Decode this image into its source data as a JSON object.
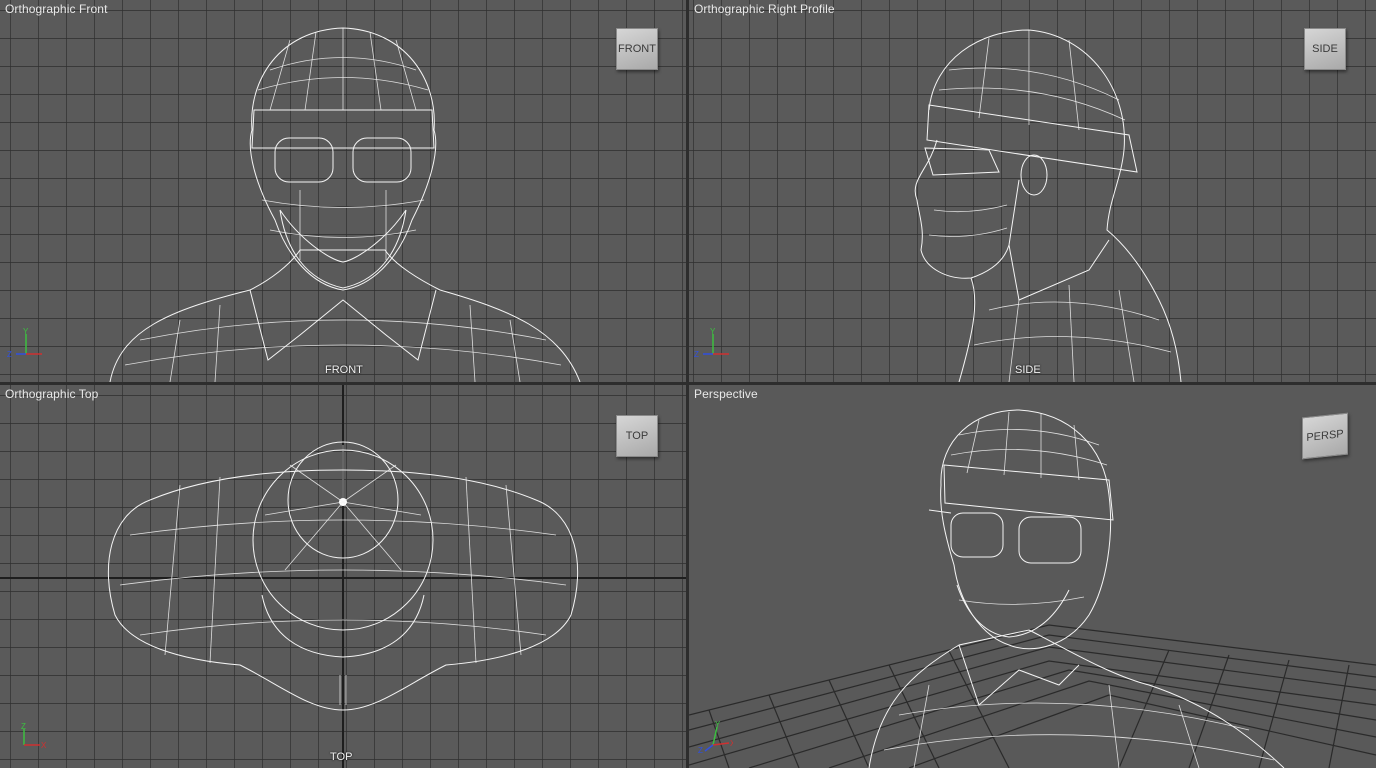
{
  "viewports": {
    "front": {
      "title": "Orthographic Front",
      "cube_label": "FRONT",
      "bottom_label": "FRONT"
    },
    "side": {
      "title": "Orthographic Right Profile",
      "cube_label": "SIDE",
      "bottom_label": "SIDE"
    },
    "top": {
      "title": "Orthographic Top",
      "cube_label": "TOP",
      "bottom_label": "TOP"
    },
    "persp": {
      "title": "Perspective",
      "cube_label": "PERSP"
    }
  },
  "axis_labels": {
    "x": "X",
    "y": "Y",
    "z": "Z"
  },
  "colors": {
    "viewport_bg": "#5a5a5a",
    "grid_line": "#2e2e2e",
    "wireframe": "#f4f4f4",
    "axis_x": "#d03030",
    "axis_y": "#3cc040",
    "axis_z": "#3050e0"
  },
  "icons": [
    "axis-gizmo-icon",
    "view-cube-icon"
  ]
}
